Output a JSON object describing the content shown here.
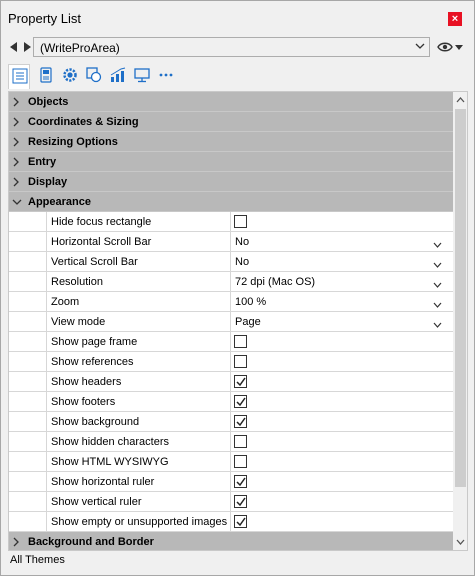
{
  "window": {
    "title": "Property List",
    "close_label": "×"
  },
  "selector": {
    "value": "(WriteProArea)"
  },
  "toolbar": {
    "tools": [
      {
        "icon": "list-icon"
      },
      {
        "icon": "object-icon"
      },
      {
        "icon": "gear-icon"
      },
      {
        "icon": "shapes-icon"
      },
      {
        "icon": "chart-icon"
      },
      {
        "icon": "monitor-icon"
      },
      {
        "icon": "more-icon"
      }
    ]
  },
  "groups": {
    "objects": "Objects",
    "coordinates": "Coordinates & Sizing",
    "resizing": "Resizing Options",
    "entry": "Entry",
    "display": "Display",
    "appearance": "Appearance",
    "background": "Background and Border"
  },
  "properties": [
    {
      "name": "Hide focus rectangle",
      "type": "checkbox",
      "checked": false
    },
    {
      "name": "Horizontal Scroll Bar",
      "type": "dropdown",
      "value": "No"
    },
    {
      "name": "Vertical Scroll Bar",
      "type": "dropdown",
      "value": "No"
    },
    {
      "name": "Resolution",
      "type": "dropdown",
      "value": "72 dpi (Mac OS)"
    },
    {
      "name": "Zoom",
      "type": "dropdown",
      "value": "100 %"
    },
    {
      "name": "View mode",
      "type": "dropdown",
      "value": "Page"
    },
    {
      "name": "Show page frame",
      "type": "checkbox",
      "checked": false
    },
    {
      "name": "Show references",
      "type": "checkbox",
      "checked": false
    },
    {
      "name": "Show headers",
      "type": "checkbox",
      "checked": true
    },
    {
      "name": "Show footers",
      "type": "checkbox",
      "checked": true
    },
    {
      "name": "Show background",
      "type": "checkbox",
      "checked": true
    },
    {
      "name": "Show hidden characters",
      "type": "checkbox",
      "checked": false
    },
    {
      "name": "Show HTML WYSIWYG",
      "type": "checkbox",
      "checked": false
    },
    {
      "name": "Show horizontal ruler",
      "type": "checkbox",
      "checked": true
    },
    {
      "name": "Show vertical ruler",
      "type": "checkbox",
      "checked": true
    },
    {
      "name": "Show empty or unsupported images",
      "type": "checkbox",
      "checked": true
    }
  ],
  "status": {
    "theme": "All Themes"
  },
  "colors": {
    "close": "#e81123",
    "group_bg": "#b8b8b8",
    "accent_blue": "#1e6fc8"
  }
}
